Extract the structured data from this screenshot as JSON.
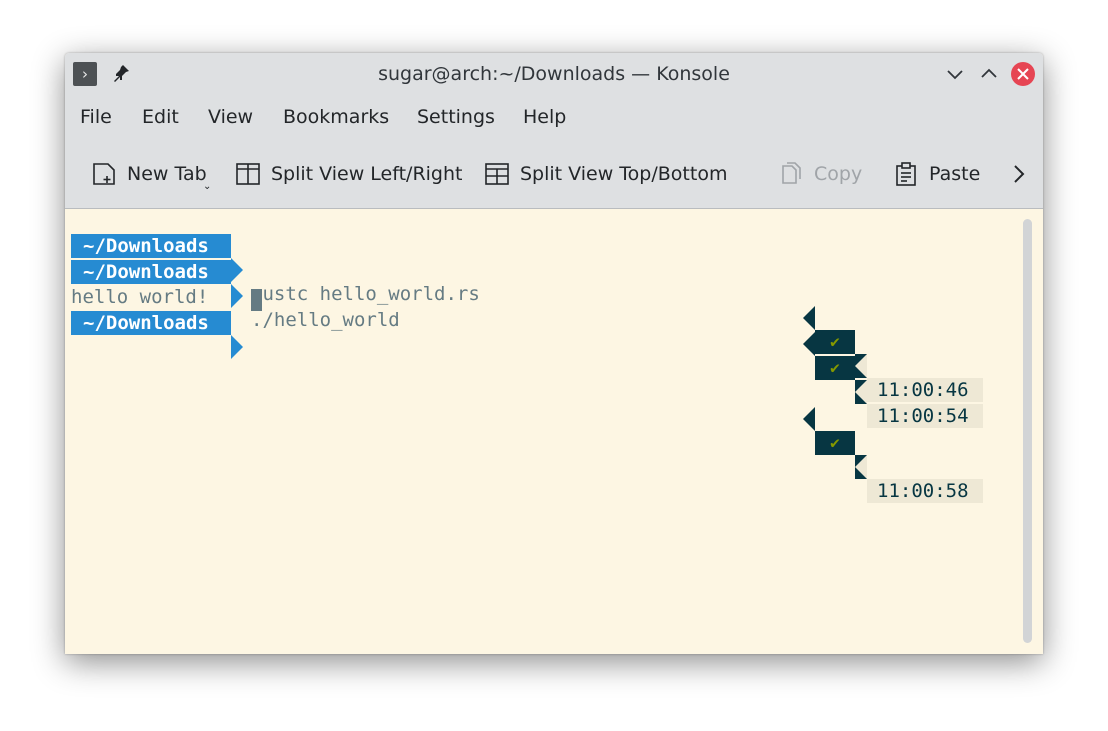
{
  "window": {
    "title": "sugar@arch:~/Downloads — Konsole"
  },
  "menubar": {
    "items": [
      "File",
      "Edit",
      "View",
      "Bookmarks",
      "Settings",
      "Help"
    ]
  },
  "toolbar": {
    "new_tab": "New Tab",
    "split_lr": "Split View Left/Right",
    "split_tb": "Split View Top/Bottom",
    "copy": "Copy",
    "paste": "Paste"
  },
  "terminal": {
    "lines": [
      {
        "dir": "~/Downloads",
        "command": "rustc hello_world.rs",
        "status": "✔",
        "time": "11:00:46"
      },
      {
        "dir": "~/Downloads",
        "command": "./hello_world",
        "status": "✔",
        "time": "11:00:54"
      },
      {
        "output": "hello world!"
      },
      {
        "dir": "~/Downloads",
        "command": "",
        "status": "✔",
        "time": "11:00:58"
      }
    ]
  },
  "colors": {
    "background": "#fdf6e3",
    "prompt_dir": "#268bd2",
    "status_bg": "#073642",
    "status_ok": "#859900",
    "time_bg": "#eee8d5",
    "close_button": "#e64553"
  }
}
